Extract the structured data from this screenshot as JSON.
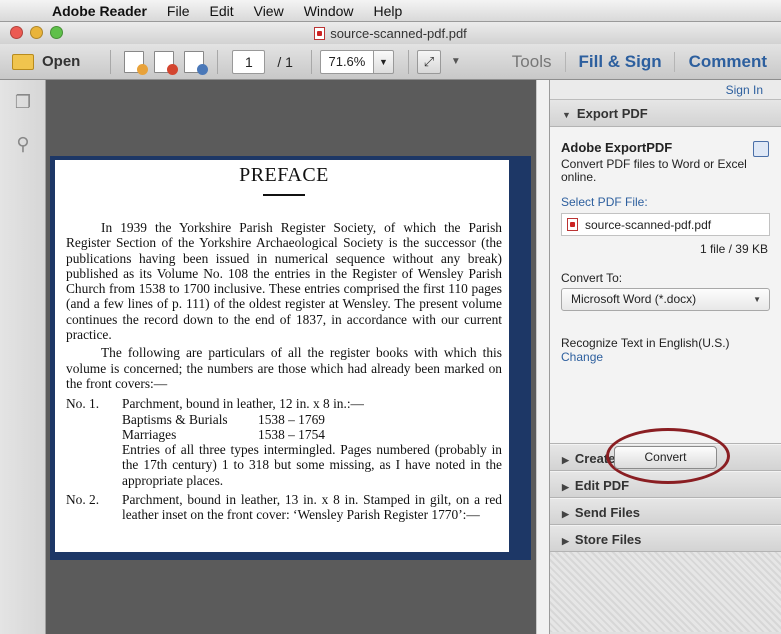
{
  "menubar": {
    "app_name": "Adobe Reader",
    "items": [
      "File",
      "Edit",
      "View",
      "Window",
      "Help"
    ]
  },
  "window": {
    "title": "source-scanned-pdf.pdf"
  },
  "toolbar": {
    "open_label": "Open",
    "current_page": "1",
    "page_separator": "/",
    "total_pages": "1",
    "zoom": "71.6%",
    "tools_label": "Tools",
    "fill_sign_label": "Fill & Sign",
    "comment_label": "Comment"
  },
  "document": {
    "title": "PREFACE",
    "para1": "In 1939 the Yorkshire Parish Register Society, of which the Parish Register Section of the Yorkshire Archaeological Society is the successor (the publications having been issued in numerical sequence without any break) published as its Volume No. 108 the entries in the Register of Wensley Parish Church from 1538 to 1700 inclusive. These entries comprised the first 110 pages (and a few lines of p. 111) of the oldest register at Wensley. The present volume continues the record down to the end of 1837, in accordance with our current practice.",
    "para2": "The following are particulars of all the register books with which this volume is concerned; the numbers are those which had already been marked on the front covers:—",
    "entries": [
      {
        "no": "No. 1.",
        "line1": "Parchment, bound in leather, 12 in. x 8 in.:—",
        "rows": [
          {
            "k": "Baptisms & Burials",
            "v": "1538 – 1769"
          },
          {
            "k": "Marriages",
            "v": "1538 – 1754"
          }
        ],
        "rest": "Entries of all three types intermingled. Pages numbered (probably in the 17th century) 1 to 318 but some missing, as I have noted in the appropriate places."
      },
      {
        "no": "No. 2.",
        "line1": "Parchment, bound in leather, 13 in. x 8 in. Stamped in gilt, on a red leather inset on the front cover: ‘Wensley Parish Register 1770’:—"
      }
    ]
  },
  "panel": {
    "sign_in": "Sign In",
    "export_pdf": "Export PDF",
    "export_title": "Adobe ExportPDF",
    "export_desc": "Convert PDF files to Word or Excel online.",
    "select_label": "Select PDF File:",
    "file_name": "source-scanned-pdf.pdf",
    "file_size": "1 file / 39 KB",
    "convert_to_label": "Convert To:",
    "convert_to_value": "Microsoft Word (*.docx)",
    "recognize": "Recognize Text in English(U.S.)",
    "change": "Change",
    "convert_button": "Convert",
    "sections": [
      "Create PDF",
      "Edit PDF",
      "Send Files",
      "Store Files"
    ]
  }
}
